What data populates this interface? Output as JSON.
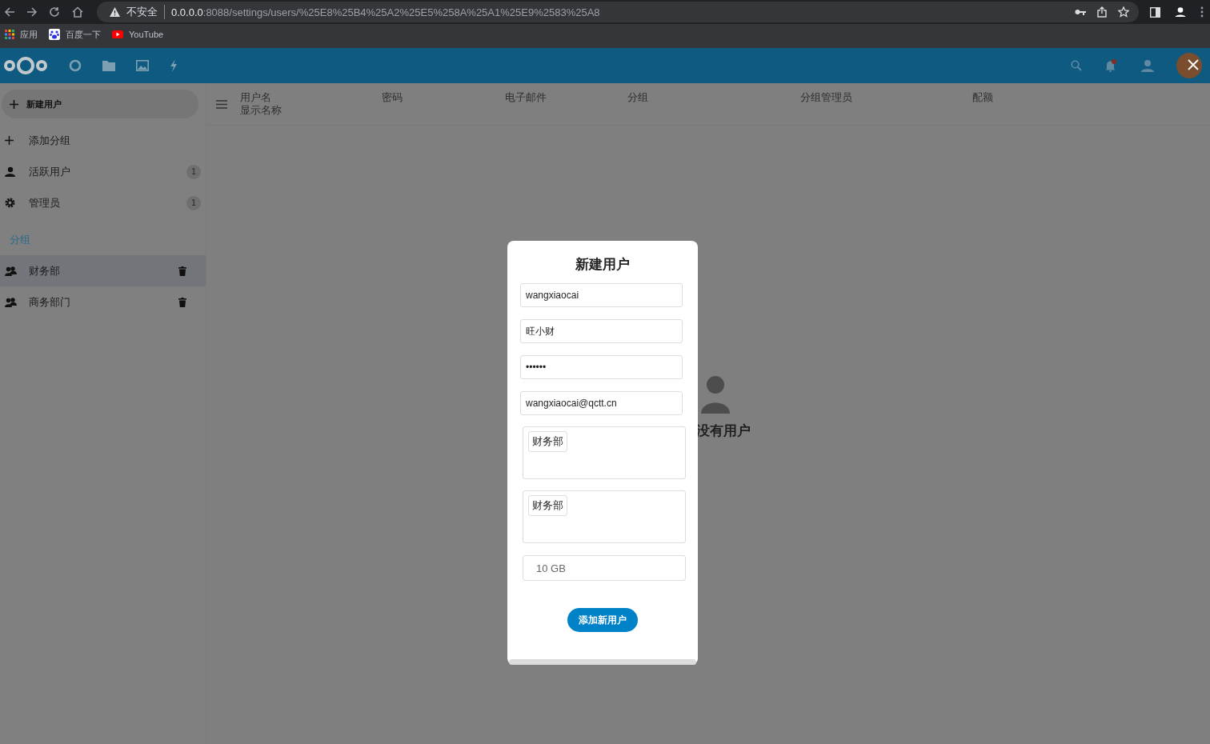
{
  "browser": {
    "url_warning": "不安全",
    "url_host": "0.0.0.0",
    "url_path": ":8088/settings/users/%25E8%25B4%25A2%25E5%258A%25A1%25E9%2583%25A8",
    "bookmarks": [
      {
        "kind": "apps",
        "label": "应用"
      },
      {
        "kind": "baidu",
        "label": "百度一下"
      },
      {
        "kind": "youtube",
        "label": "YouTube"
      }
    ]
  },
  "sidebar": {
    "new_user_button": "新建用户",
    "items": [
      {
        "kind": "add",
        "label": "添加分组"
      },
      {
        "kind": "user",
        "label": "活跃用户",
        "count": "1"
      },
      {
        "kind": "admin",
        "label": "管理员",
        "count": "1"
      }
    ],
    "groups_heading": "分组",
    "groups": [
      {
        "label": "财务部",
        "selected": true
      },
      {
        "label": "商务部门",
        "selected": false
      }
    ]
  },
  "table": {
    "columns": [
      {
        "lines": [
          "用户名",
          "显示名称"
        ]
      },
      {
        "lines": [
          "密码"
        ]
      },
      {
        "lines": [
          "电子邮件"
        ]
      },
      {
        "lines": [
          "分组"
        ]
      },
      {
        "lines": [
          "分组管理员"
        ]
      },
      {
        "lines": [
          "配额"
        ]
      }
    ]
  },
  "empty_state": "没有用户",
  "modal": {
    "title": "新建用户",
    "fields": [
      {
        "kind": "text",
        "value": "wangxiaocai"
      },
      {
        "kind": "text",
        "value": "旺小财"
      },
      {
        "kind": "text",
        "value": "••••••"
      },
      {
        "kind": "text",
        "value": "wangxiaocai@qctt.cn"
      },
      {
        "kind": "tags",
        "tags": [
          "财务部"
        ]
      },
      {
        "kind": "tags",
        "tags": [
          "财务部"
        ]
      },
      {
        "kind": "quota",
        "placeholder": "10 GB"
      }
    ],
    "submit": "添加新用户"
  }
}
